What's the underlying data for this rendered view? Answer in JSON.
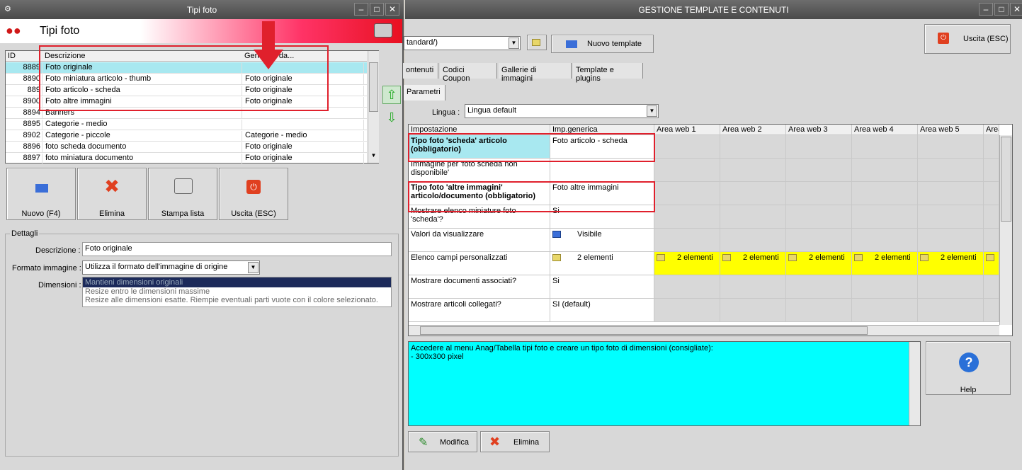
{
  "left_window": {
    "title": "Tipi foto",
    "header_title": "Tipi foto",
    "columns": [
      "ID",
      "Descrizione",
      "Generata da..."
    ],
    "rows": [
      {
        "id": "8889",
        "desc": "Foto originale",
        "gen": ""
      },
      {
        "id": "8890",
        "desc": "Foto miniatura articolo - thumb",
        "gen": "Foto originale"
      },
      {
        "id": "889",
        "desc": "Foto articolo - scheda",
        "gen": "Foto originale"
      },
      {
        "id": "8900",
        "desc": "Foto altre immagini",
        "gen": "Foto originale"
      },
      {
        "id": "8894",
        "desc": "Banners",
        "gen": ""
      },
      {
        "id": "8895",
        "desc": "Categorie - medio",
        "gen": ""
      },
      {
        "id": "8902",
        "desc": "Categorie - piccole",
        "gen": "Categorie - medio"
      },
      {
        "id": "8896",
        "desc": "foto scheda documento",
        "gen": "Foto originale"
      },
      {
        "id": "8897",
        "desc": "foto miniatura documento",
        "gen": "Foto originale"
      }
    ],
    "buttons": {
      "new": "Nuovo (F4)",
      "delete": "Elimina",
      "print": "Stampa lista",
      "exit": "Uscita (ESC)"
    },
    "details": {
      "group": "Dettagli",
      "desc_label": "Descrizione :",
      "desc_value": "Foto originale",
      "format_label": "Formato immagine :",
      "format_value": "Utilizza il formato dell'immagine di origine",
      "dims_label": "Dimensioni :",
      "dims_options": [
        "Mantieni dimensioni originali",
        "Resize entro le dimensioni massime",
        "Resize alle dimensioni esatte. Riempie eventuali parti vuote con il colore selezionato."
      ]
    }
  },
  "right_window": {
    "title": "GESTIONE TEMPLATE E CONTENUTI",
    "template_combo": "tandard/)",
    "new_template": "Nuovo template",
    "exit": "Uscita (ESC)",
    "tabs": [
      "ontenuti",
      "Codici Coupon",
      "Gallerie di immagini",
      "Template e plugins"
    ],
    "subtab": "Parametri",
    "language_label": "Lingua :",
    "language_value": "Lingua default",
    "grid_headers": [
      "Impostazione",
      "Imp.generica",
      "Area web 1",
      "Area web 2",
      "Area web 3",
      "Area web 4",
      "Area web 5",
      "Area"
    ],
    "grid_rows": [
      {
        "name": "Tipo foto 'scheda' articolo (obbligatorio)",
        "value": "Foto articolo - scheda"
      },
      {
        "name": "Immagine per 'foto scheda non disponibile'",
        "value": ""
      },
      {
        "name": "Tipo foto 'altre immagini' articolo/documento (obbligatorio)",
        "value": "Foto altre immagini"
      },
      {
        "name": "Mostrare elenco miniature foto 'scheda'?",
        "value": "Si"
      },
      {
        "name": "Valori da visualizzare",
        "value": "Visibile"
      },
      {
        "name": "Elenco campi personalizzati",
        "value": "2 elementi"
      },
      {
        "name": "Mostrare documenti associati?",
        "value": "Si"
      },
      {
        "name": "Mostrare articoli collegati?",
        "value": "SI (default)"
      }
    ],
    "area_value": "2 elementi",
    "note_text": "Accedere al menu Anag/Tabella tipi foto e creare un tipo foto di dimensioni (consigliate):",
    "note_line2": "- 300x300 pixel",
    "help": "Help",
    "edit": "Modifica",
    "delete": "Elimina"
  },
  "colors": {
    "selection": "#a8e8f0",
    "note_bg": "#00ffff",
    "highlight": "#ffff00",
    "annotation": "#e0202c"
  }
}
